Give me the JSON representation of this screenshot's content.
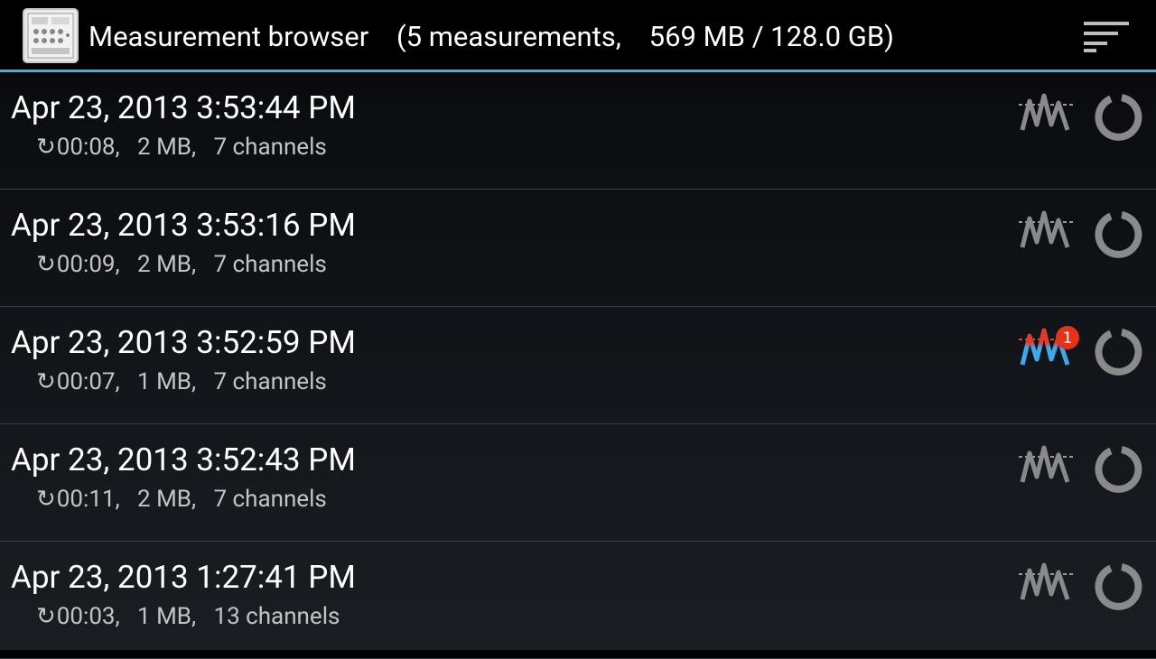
{
  "actionbar": {
    "title": "Measurement browser    (5 measurements,    569 MB / 128.0 GB)"
  },
  "measurements": [
    {
      "datetime": "Apr 23, 2013 3:53:44 PM",
      "duration": "00:08",
      "size": "2 MB",
      "channels": "7 channels",
      "viewer_badge": null,
      "viewer_active": false
    },
    {
      "datetime": "Apr 23, 2013 3:53:16 PM",
      "duration": "00:09",
      "size": "2 MB",
      "channels": "7 channels",
      "viewer_badge": null,
      "viewer_active": false
    },
    {
      "datetime": "Apr 23, 2013 3:52:59 PM",
      "duration": "00:07",
      "size": "1 MB",
      "channels": "7 channels",
      "viewer_badge": "1",
      "viewer_active": true
    },
    {
      "datetime": "Apr 23, 2013 3:52:43 PM",
      "duration": "00:11",
      "size": "2 MB",
      "channels": "7 channels",
      "viewer_badge": null,
      "viewer_active": false
    },
    {
      "datetime": "Apr 23, 2013 1:27:41 PM",
      "duration": "00:03",
      "size": "1 MB",
      "channels": "13 channels",
      "viewer_badge": null,
      "viewer_active": false
    }
  ],
  "icons": {
    "app": "device-icon",
    "overflow": "sort-menu-icon",
    "duration": "refresh-icon",
    "viewer": "waveform-icon",
    "status": "circle-refresh-icon"
  },
  "colors": {
    "accent": "#33b5e5",
    "badge": "#e8311a",
    "wave_active_red": "#e23b2b",
    "wave_active_blue": "#3fa7ee",
    "wave_inactive": "#8a8a8a"
  }
}
